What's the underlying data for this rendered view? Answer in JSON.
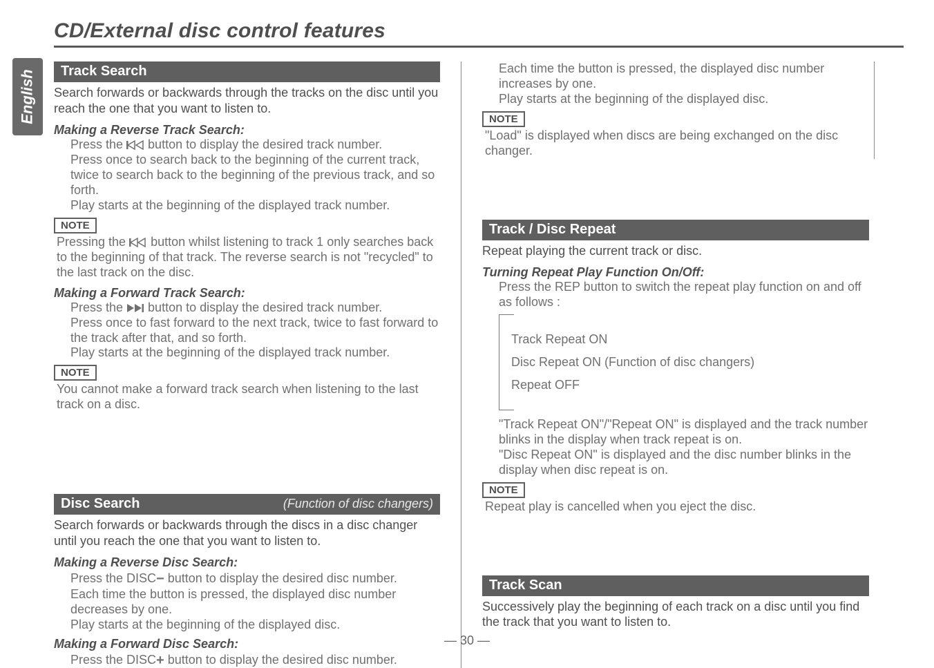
{
  "sideTab": "English",
  "pageTitle": "CD/External disc control features",
  "pageNumber": "— 30 —",
  "noteLabel": "NOTE",
  "left": {
    "trackSearch": {
      "bar": "Track Search",
      "intro": "Search forwards or backwards through the tracks on the disc until you reach the one that you want to listen to.",
      "reverse": {
        "heading": "Making a Reverse Track Search:",
        "line1a": "Press the ",
        "line1b": " button to display the desired track number.",
        "line2": "Press once to search back to the beginning of the current track, twice to search back to the beginning of the previous track, and so forth.",
        "line3": "Play starts at the beginning of the displayed track number.",
        "note1a": "Pressing the ",
        "note1b": " button whilst listening to track 1 only searches back to the beginning of that track. The reverse search is not \"recycled\" to the last track on the disc."
      },
      "forward": {
        "heading": "Making a Forward Track Search:",
        "line1a": "Press the ",
        "line1b": " button to display the desired track number.",
        "line2": "Press once to fast forward to the next track, twice to fast forward to the track after that, and so forth.",
        "line3": "Play starts at the beginning of the displayed track number.",
        "note": "You cannot make a forward track search when listening to the last track on a disc."
      }
    },
    "discSearch": {
      "bar": "Disc Search",
      "barSub": "(Function of disc changers)",
      "intro": "Search forwards or backwards through the discs in a disc changer until you reach the one that you want to listen to.",
      "reverse": {
        "heading": "Making a Reverse Disc Search:",
        "line1a": "Press the DISC",
        "line1b": " button to display the desired disc number.",
        "line2": "Each time the button is pressed, the displayed disc number decreases by one.",
        "line3": "Play starts at the beginning of the displayed disc."
      },
      "forward": {
        "heading": "Making a Forward Disc Search:",
        "line1a": "Press the DISC",
        "line1b": " button to display the desired disc number."
      }
    }
  },
  "right": {
    "cont": {
      "line1": "Each time the button is pressed, the displayed disc number increases by one.",
      "line2": "Play starts at the beginning of the displayed disc.",
      "note": "\"Load\" is displayed when discs are being exchanged on the disc changer."
    },
    "repeat": {
      "bar": "Track / Disc Repeat",
      "intro": "Repeat playing the current track or disc.",
      "heading": "Turning Repeat Play Function On/Off:",
      "line1": "Press the REP button to switch the repeat play function on and off as follows :",
      "opt1": "Track Repeat ON",
      "opt2": "Disc Repeat ON (Function of disc changers)",
      "opt3": "Repeat OFF",
      "desc1": "\"Track Repeat ON\"/\"Repeat ON\" is displayed and the track number blinks in the display when track repeat is on.",
      "desc2": "\"Disc Repeat ON\" is displayed and the disc number blinks in the display when disc repeat is on.",
      "note": "Repeat play is cancelled when you eject the disc."
    },
    "scan": {
      "bar": "Track Scan",
      "intro": "Successively play the beginning of each track on a disc until you find the track that you want to listen to."
    }
  }
}
